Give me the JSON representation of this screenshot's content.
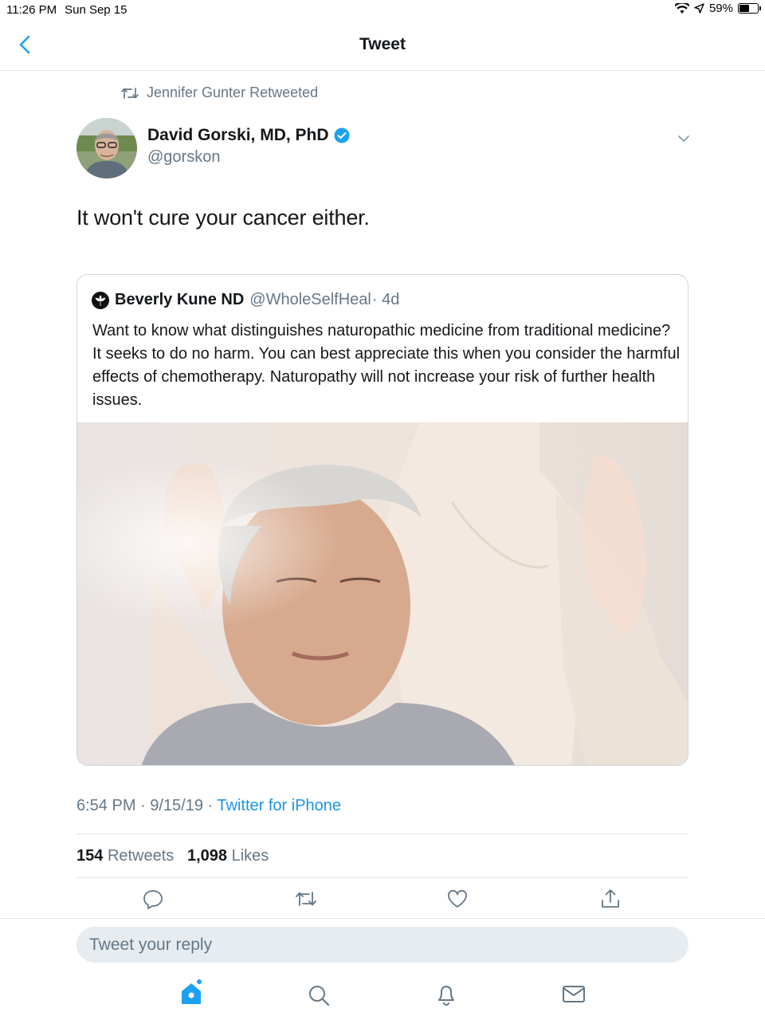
{
  "status_bar": {
    "time": "11:26 PM",
    "date": "Sun Sep 15",
    "battery": "59%",
    "battery_level": 0.59
  },
  "nav": {
    "title": "Tweet"
  },
  "retweet_context": "Jennifer Gunter Retweeted",
  "tweet": {
    "author_name": "David Gorski, MD, PhD",
    "author_handle": "@gorskon",
    "text": "It won't cure your cancer either.",
    "timestamp": "6:54 PM · 9/15/19 · ",
    "source": "Twitter for iPhone",
    "retweets_count": "154",
    "retweets_label": "Retweets",
    "likes_count": "1,098",
    "likes_label": "Likes"
  },
  "quoted_tweet": {
    "author_name": "Beverly Kune ND",
    "author_handle": "@WholeSelfHeal",
    "age": "· 4d",
    "text": "Want to know what distinguishes naturopathic medicine from traditional medicine? It seeks to do no harm. You can best appreciate this when you consider the harmful effects of chemotherapy. Naturopathy will not increase your risk of further health issues."
  },
  "reply_box": {
    "placeholder": "Tweet your reply"
  },
  "icons": {
    "back": "chevron-left-icon",
    "retweet_context": "retweet-icon",
    "verified": "verified-badge-icon",
    "caret": "chevron-down-icon",
    "reply": "reply-icon",
    "retweet": "retweet-icon",
    "like": "heart-icon",
    "share": "share-icon",
    "home": "home-icon",
    "search": "search-icon",
    "notifications": "bell-icon",
    "messages": "mail-icon"
  },
  "colors": {
    "accent": "#1da1f2",
    "link": "#1b95e0",
    "secondary_text": "#657786",
    "divider": "#e1e8ed"
  }
}
